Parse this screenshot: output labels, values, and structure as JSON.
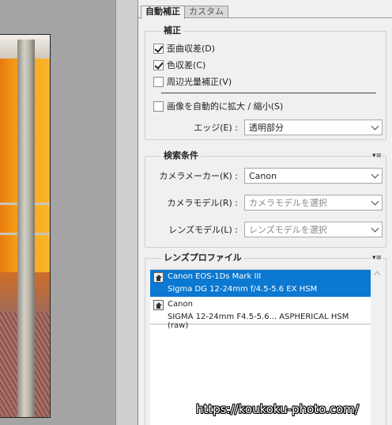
{
  "tabs": [
    {
      "label": "自動補正",
      "active": true
    },
    {
      "label": "カスタム",
      "active": false
    }
  ],
  "correction": {
    "title": "補正",
    "options": [
      {
        "label": "歪曲収差(D)",
        "checked": true
      },
      {
        "label": "色収差(C)",
        "checked": true
      },
      {
        "label": "周辺光量補正(V)",
        "checked": false
      }
    ],
    "auto_scale": {
      "label": "画像を自動的に拡大 / 縮小(S)",
      "checked": false
    },
    "edge": {
      "label": "エッジ(E) :",
      "value": "透明部分"
    }
  },
  "search": {
    "title": "検索条件",
    "menu_icon": "▾≡",
    "camera_maker": {
      "label": "カメラメーカー(K) :",
      "value": "Canon"
    },
    "camera_model": {
      "label": "カメラモデル(R) :",
      "value": "カメラモデルを選択"
    },
    "lens_model": {
      "label": "レンズモデル(L) :",
      "value": "レンズモデルを選択"
    }
  },
  "profiles": {
    "title": "レンズプロファイル",
    "menu_icon": "▾≡",
    "items": [
      {
        "camera": "Canon EOS-1Ds Mark III",
        "lens": "Sigma DG 12-24mm f/4.5-5.6 EX HSM",
        "selected": true
      },
      {
        "camera": "Canon",
        "lens": "SIGMA 12-24mm F4.5-5.6... ASPHERICAL HSM (raw)",
        "selected": false
      }
    ]
  },
  "watermark": "https://koukoku-photo.com/",
  "colors": {
    "selection": "#0b78d1",
    "panel_bg": "#f0f0f0"
  }
}
